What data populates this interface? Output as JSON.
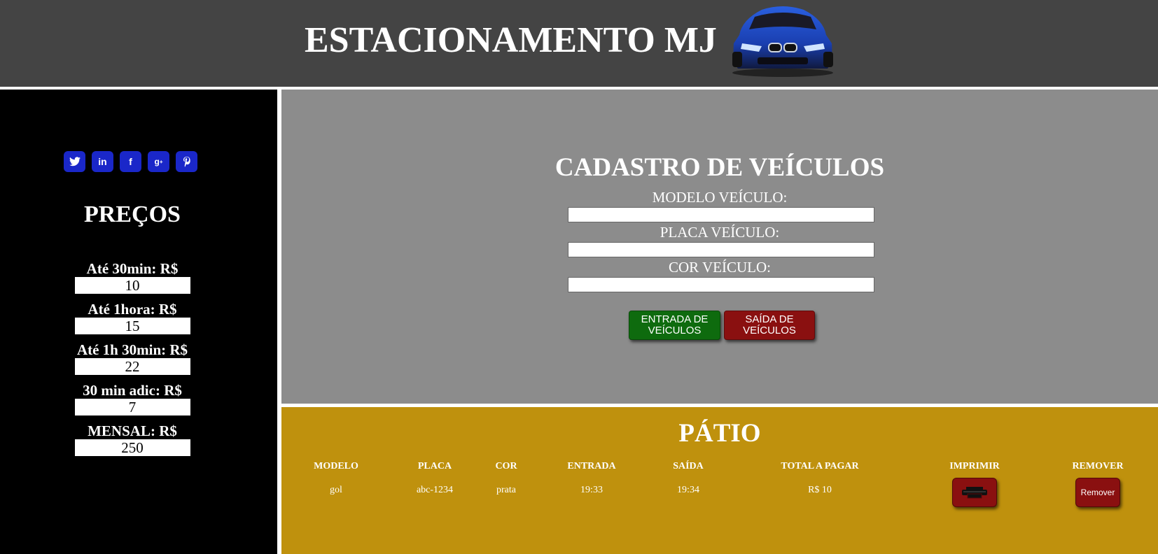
{
  "header": {
    "title": "ESTACIONAMENTO MJ",
    "car_image": "car-icon"
  },
  "sidebar": {
    "social": [
      {
        "icon": "twitter-icon",
        "glyph": "🐦"
      },
      {
        "icon": "linkedin-icon",
        "glyph": "in"
      },
      {
        "icon": "facebook-icon",
        "glyph": "f"
      },
      {
        "icon": "google-plus-icon",
        "glyph": "g+"
      },
      {
        "icon": "pinterest-icon",
        "glyph": "P"
      }
    ],
    "precos_title": "PREÇOS",
    "prices": [
      {
        "label": "Até 30min: R$",
        "value": "10"
      },
      {
        "label": "Até 1hora: R$",
        "value": "15"
      },
      {
        "label": "Até 1h 30min: R$",
        "value": "22"
      },
      {
        "label": "30 min adic: R$",
        "value": "7"
      },
      {
        "label": "MENSAL: R$",
        "value": "250"
      }
    ]
  },
  "cadastro": {
    "title": "CADASTRO DE VEÍCULOS",
    "modelo_label": "MODELO VEÍCULO:",
    "modelo_value": "",
    "placa_label": "PLACA VEÍCULO:",
    "placa_value": "",
    "cor_label": "COR VEÍCULO:",
    "cor_value": "",
    "entrada_line1": "ENTRADA DE",
    "entrada_line2": "VEÍCULOS",
    "saida_line1": "SAÍDA DE",
    "saida_line2": "VEÍCULOS"
  },
  "patio": {
    "title": "PÁTIO",
    "columns": [
      "MODELO",
      "PLACA",
      "COR",
      "ENTRADA",
      "SAÍDA",
      "TOTAL A PAGAR",
      "IMPRIMIR",
      "REMOVER"
    ],
    "rows": [
      {
        "modelo": "gol",
        "placa": "abc-1234",
        "cor": "prata",
        "entrada": "19:33",
        "saida": "19:34",
        "total": "R$ 10",
        "imprimir_icon": "printer-icon",
        "remover_label": "Remover"
      }
    ]
  },
  "colors": {
    "header_bg": "#444444",
    "sidebar_bg": "#000000",
    "cadastro_bg": "#8c8c8c",
    "patio_bg": "#bf910d",
    "social_bg": "#1a27c9",
    "entrada_btn": "#0e6b0e",
    "saida_btn": "#8a1010"
  }
}
